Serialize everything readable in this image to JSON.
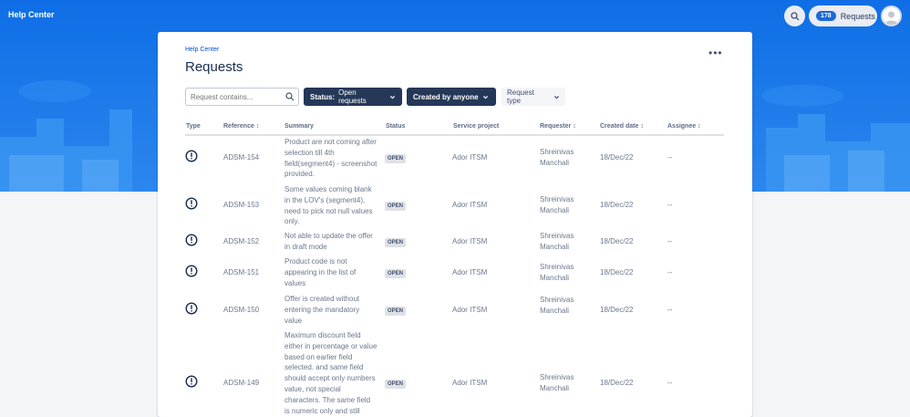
{
  "topbar": {
    "brand": "Help Center",
    "requests_count": "178",
    "requests_label": "Requests"
  },
  "panel": {
    "breadcrumb": "Help Center",
    "title": "Requests",
    "more_label": "•••"
  },
  "filters": {
    "search_placeholder": "Request contains...",
    "status_prefix": "Status:",
    "status_value": "Open requests",
    "created_by": "Created by anyone",
    "request_type": "Request type"
  },
  "table": {
    "headers": {
      "type": "Type",
      "reference": "Reference",
      "summary": "Summary",
      "status": "Status",
      "service_project": "Service project",
      "requester": "Requester",
      "created_date": "Created date",
      "assignee": "Assignee"
    },
    "sort_glyph": "↕",
    "rows": [
      {
        "reference": "ADSM-154",
        "summary": "Product are not coming after selection till 4th field(segment4) - screenshot provided.",
        "status": "OPEN",
        "project": "Ador ITSM",
        "requester": "Shreinivas Manchali",
        "created": "18/Dec/22",
        "assignee": "--"
      },
      {
        "reference": "ADSM-153",
        "summary": "Some values coming blank in the LOV's (segment4), need to pick not null values only.",
        "status": "OPEN",
        "project": "Ador ITSM",
        "requester": "Shreinivas Manchali",
        "created": "18/Dec/22",
        "assignee": "--"
      },
      {
        "reference": "ADSM-152",
        "summary": "Not able to update the offer in draft mode",
        "status": "OPEN",
        "project": "Ador ITSM",
        "requester": "Shreinivas Manchali",
        "created": "18/Dec/22",
        "assignee": "--"
      },
      {
        "reference": "ADSM-151",
        "summary": "Product code is not appearing in the list of values",
        "status": "OPEN",
        "project": "Ador ITSM",
        "requester": "Shreinivas Manchali",
        "created": "18/Dec/22",
        "assignee": "--"
      },
      {
        "reference": "ADSM-150",
        "summary": "Offer is created without entering the mandatory value",
        "status": "OPEN",
        "project": "Ador ITSM",
        "requester": "Shreinivas Manchali",
        "created": "18/Dec/22",
        "assignee": "--"
      },
      {
        "reference": "ADSM-149",
        "summary": "Maximum discount field either in percentage or value based on earlier field selected. and same field should accept only numbers value, not special characters. The same field is numeric only and still",
        "status": "OPEN",
        "project": "Ador ITSM",
        "requester": "Shreinivas Manchali",
        "created": "18/Dec/22",
        "assignee": "--"
      }
    ]
  }
}
